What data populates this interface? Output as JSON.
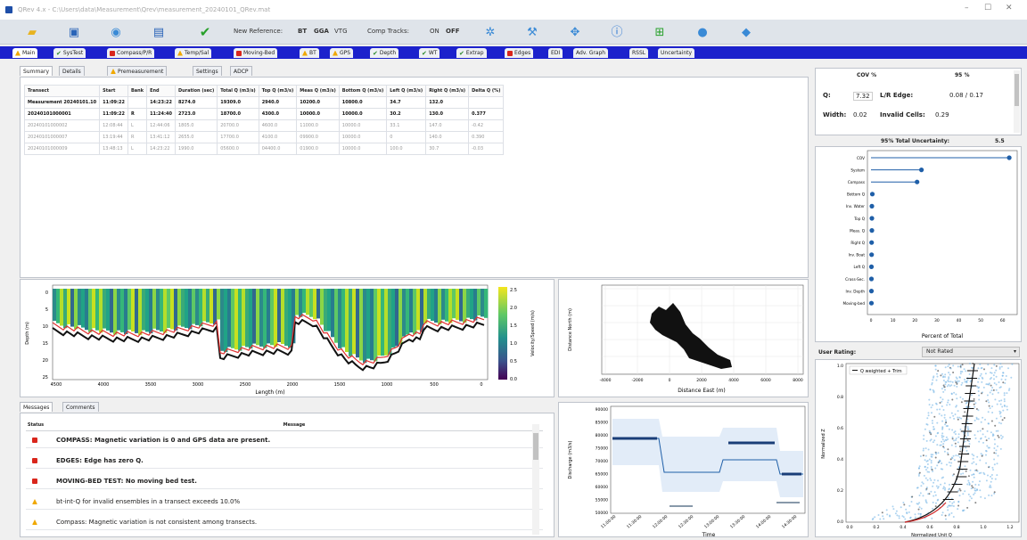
{
  "window": {
    "title": "QRev 4.x - C:\\Users\\data\\Measurement\\Qrev\\measurement_20240101_QRev.mat",
    "controls": [
      "–",
      "☐",
      "✕"
    ]
  },
  "toolbar": {
    "new_reference_label": "New Reference:",
    "reference_options": [
      "BT",
      "GGA",
      "VTG"
    ],
    "comp_tracks_label": "Comp Tracks:",
    "comp_tracks_options": [
      "ON",
      "OFF"
    ]
  },
  "main_tabs": [
    {
      "label": "Main",
      "status": "warn"
    },
    {
      "label": "SysTest",
      "status": "ok"
    },
    {
      "label": "Compass/P/R",
      "status": "err"
    },
    {
      "label": "Temp/Sal",
      "status": "warn"
    },
    {
      "label": "Moving-Bed",
      "status": "err"
    },
    {
      "label": "BT",
      "status": "warn"
    },
    {
      "label": "GPS",
      "status": "warn"
    },
    {
      "label": "Depth",
      "status": "ok"
    },
    {
      "label": "WT",
      "status": "ok"
    },
    {
      "label": "Extrap",
      "status": "ok"
    },
    {
      "label": "Edges",
      "status": "err"
    },
    {
      "label": "EDI",
      "status": "none"
    },
    {
      "label": "Adv. Graph",
      "status": "none"
    },
    {
      "label": "RSSL",
      "status": "none"
    },
    {
      "label": "Uncertainty",
      "status": "none"
    }
  ],
  "summary_tabs": [
    {
      "label": "Summary",
      "status": "none"
    },
    {
      "label": "Details",
      "status": "none"
    },
    {
      "label": "Premeasurement",
      "status": "warn"
    },
    {
      "label": "Settings",
      "status": "none"
    },
    {
      "label": "ADCP",
      "status": "none"
    }
  ],
  "summary_table": {
    "columns": [
      "Transect",
      "Start",
      "Bank",
      "End",
      "Duration (sec)",
      "Total Q (m3/s)",
      "Top Q (m3/s)",
      "Meas Q (m3/s)",
      "Bottom Q (m3/s)",
      "Left Q (m3/s)",
      "Right Q (m3/s)",
      "Delta Q (%)"
    ],
    "rows": [
      [
        "Measurement 20240101.10",
        "11:09:22",
        "",
        "14:23:22",
        "8274.0",
        "19309.0",
        "2940.0",
        "10200.0",
        "10800.0",
        "34.7",
        "132.0",
        ""
      ],
      [
        "20240101000001",
        "11:09:22",
        "R",
        "11:24:40",
        "2723.0",
        "18700.0",
        "4300.0",
        "10000.0",
        "10000.0",
        "30.2",
        "130.0",
        "0.377"
      ],
      [
        "20240101000002",
        "12:08:44",
        "L",
        "12:44:06",
        "1805.0",
        "20700.0",
        "4600.0",
        "11000.0",
        "10000.0",
        "33.1",
        "147.0",
        "-0.42"
      ],
      [
        "20240101000007",
        "13:19:44",
        "R",
        "13:41:12",
        "2655.0",
        "17700.0",
        "4100.0",
        "09900.0",
        "10000.0",
        "0",
        "140.0",
        "0.390"
      ],
      [
        "20240101000009",
        "13:48:13",
        "L",
        "14:23:22",
        "1990.0",
        "05600.0",
        "04400.0",
        "01900.0",
        "10000.0",
        "100.0",
        "30.7",
        "-0.03"
      ]
    ]
  },
  "contour": {
    "ylabel": "Depth (m)",
    "xlabel": "Length (m)",
    "yticks": [
      "0",
      "5",
      "10",
      "15",
      "20",
      "25"
    ],
    "xticks": [
      "4500",
      "4000",
      "3500",
      "3000",
      "2500",
      "2000",
      "1500",
      "1000",
      "500",
      "0"
    ],
    "colorbar_ticks": [
      "2.5",
      "2.0",
      "1.5",
      "1.0",
      "0.5",
      "0.0"
    ],
    "colorbar_label": "Velocity/Speed (m/s)"
  },
  "shiptrack": {
    "ylabel": "Distance North (m)",
    "xlabel": "Distance East (m)",
    "xticks": [
      "-4000",
      "-2000",
      "0",
      "2000",
      "4000",
      "6000",
      "8000"
    ]
  },
  "messages_tabs": [
    {
      "label": "Messages"
    },
    {
      "label": "Comments"
    }
  ],
  "messages": {
    "col_status": "Status",
    "col_message": "Message",
    "rows": [
      {
        "level": "err",
        "text": "COMPASS: Magnetic variation is 0 and GPS data are present."
      },
      {
        "level": "err",
        "text": "EDGES: Edge has zero Q."
      },
      {
        "level": "err",
        "text": "MOVING-BED TEST: No moving bed test."
      },
      {
        "level": "warn",
        "text": "bt-int-Q for invalid ensembles in a transect exceeds 10.0%"
      },
      {
        "level": "warn",
        "text": "Compass: Magnetic variation is not consistent among transects."
      }
    ]
  },
  "discharge_ts": {
    "ylabel": "Discharge (m3/s)",
    "xlabel": "Time",
    "yticks": [
      "90000",
      "85000",
      "80000",
      "75000",
      "70000",
      "65000",
      "60000",
      "55000",
      "50000"
    ],
    "xticks": [
      "11:00:00",
      "11:30:00",
      "12:00:00",
      "12:30:00",
      "13:00:00",
      "13:30:00",
      "14:00:00",
      "14:30:00"
    ]
  },
  "uncertainty": {
    "col_cov": "COV %",
    "col_95": "95 %",
    "row_q": "Q:",
    "row_q_cov": "7.32",
    "lr_edge_label": "L/R Edge:",
    "lr_edge_value": "0.08 / 0.17",
    "width_label": "Width:",
    "width_value": "0.02",
    "invalid_cells_label": "Invalid Cells:",
    "invalid_cells_value": "0.29",
    "total_label": "95% Total Uncertainty:",
    "total_value": "5.5"
  },
  "unc_chart": {
    "categories": [
      "COV",
      "System",
      "Compass",
      "Bottom Q",
      "Inv. Water",
      "Top Q",
      "Meas. Q",
      "Right Q",
      "Inv. Boat",
      "Left Q",
      "Cross-Sec.",
      "Inv. Depth",
      "Moving-bed"
    ],
    "values": [
      63,
      23,
      21,
      0.6,
      0.4,
      0.4,
      0.4,
      0.3,
      0.3,
      0.2,
      0.2,
      0.2,
      0.2
    ],
    "xlabel": "Percent of Total",
    "xlim": [
      0,
      65
    ],
    "xticks": [
      "0",
      "10",
      "20",
      "30",
      "40",
      "50",
      "60"
    ]
  },
  "user_rating": {
    "label": "User Rating:",
    "value": "Not Rated"
  },
  "extrap": {
    "legend": "Q weighted + Trim",
    "ylabel": "Normalized Z",
    "xlabel": "Normalized Unit Q",
    "yticks": [
      "1.0",
      "0.8",
      "0.6",
      "0.4",
      "0.2",
      "0.0"
    ],
    "xticks": [
      "0.0",
      "0.2",
      "0.4",
      "0.6",
      "0.8",
      "1.0",
      "1.2"
    ]
  },
  "colors": {
    "tabstrip": "#1c22cc",
    "error": "#d9261c",
    "warning": "#f0a800",
    "ok": "#2d8a2d",
    "series": "#1f5fa8"
  }
}
